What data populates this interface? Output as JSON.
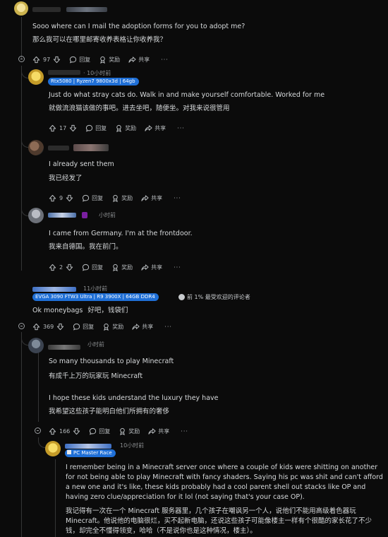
{
  "comments": {
    "c0": {
      "body_en": "Sooo where can I mail the adoption forms for you to adopt me?",
      "body_zh": "那么我可以在哪里邮寄收养表格让你收养我？",
      "votes": "97"
    },
    "c1": {
      "time": "· 10小时前",
      "flair": "Rtx5080 | Ryzen7 9800x3d | 64gb",
      "body_en": "Just do what stray cats do. Walk in and make yourself comfortable. Worked for me",
      "body_zh": "就做流浪猫该做的事吧。进去坐吧，随便坐。对我来说很管用",
      "votes": "17"
    },
    "c2": {
      "body_en": "I already sent them",
      "body_zh": "我已经发了",
      "votes": "9"
    },
    "c3": {
      "time": "小时前",
      "body_en": "I came from Germany. I'm at the frontdoor.",
      "body_zh": "我来自德国。我在前门。",
      "votes": "2"
    },
    "c4": {
      "time": "11小时前",
      "flair": "EVGA 3090 FTW3 Ultra | R9 3900X | 64GB DDR4",
      "badge": "前 1% 最受欢迎的评论者",
      "body_en": "Ok moneybags",
      "body_zh": "好吧，钱袋们",
      "votes": "369"
    },
    "c5": {
      "time": "小时前",
      "body_en_1": "So many thousands to play Minecraft",
      "body_zh_1": "有成千上万的玩家玩 Minecraft",
      "body_en_2": "I hope these kids understand the luxury they have",
      "body_zh_2": "我希望这些孩子能明白他们所拥有的奢侈",
      "votes": "166"
    },
    "c6": {
      "time": "10小时前",
      "flair": "PC Master Race",
      "body_en": "I remember being in a Minecraft server once where a couple of kids were shitting on another for not being able to play Minecraft with fancy shaders. Saying his pc was shit and can't afford a new one and it's like, these kids probably had a cool parent shell out stacks like OP and having zero clue/appreciation for it lol (not saying that's your case OP).",
      "body_zh": "我记得有一次在一个 Minecraft 服务器里，几个孩子在嘲讽另一个人，说他们不能用高级着色器玩 Minecraft。他说他的电脑很烂，买不起新电脑，还说这些孩子可能像楼主一样有个很酷的家长花了不少钱，却完全不懂得领变，哈哈（不是说你也是这种情况，楼主）。"
    }
  },
  "actions": {
    "reply": "回复",
    "award": "奖励",
    "share": "共享",
    "more": "···"
  },
  "colors": {
    "background": "#0b0b0b",
    "flair_blue": "#1f6fd6",
    "rail": "#343536"
  }
}
